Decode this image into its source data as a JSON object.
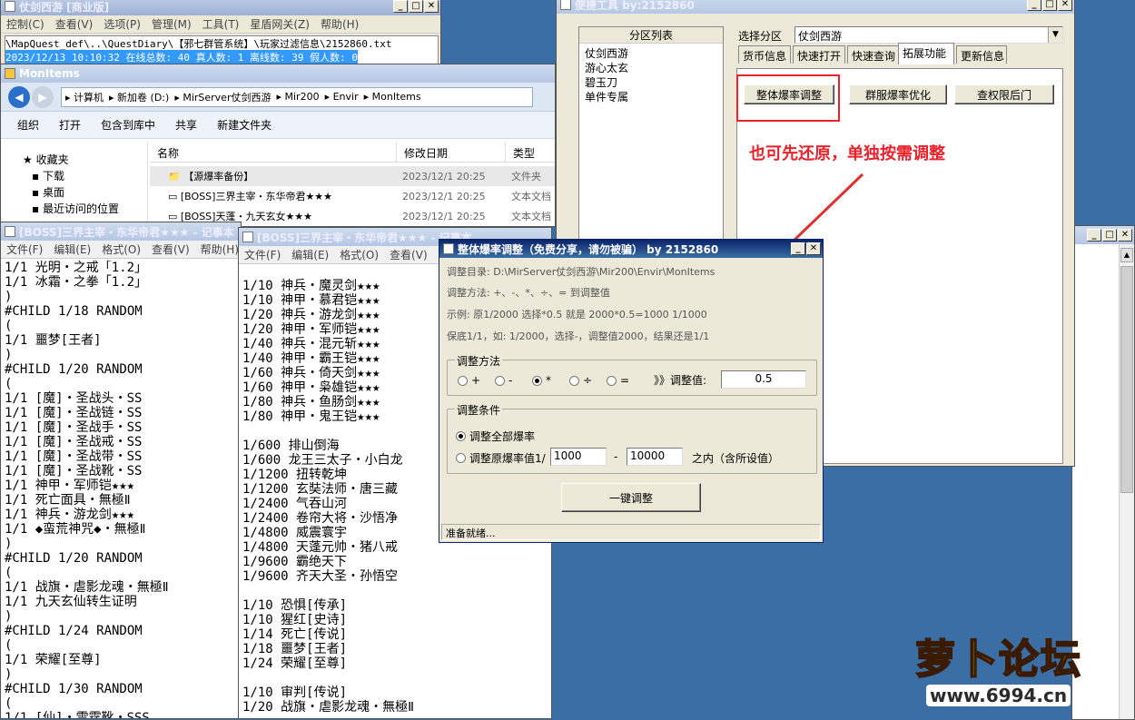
{
  "win_top_left": {
    "title": "仗剑西游 [商业版]",
    "menu": [
      "控制(C)",
      "查看(V)",
      "选项(P)",
      "管理(M)",
      "工具(T)",
      "星盾网关(Z)",
      "帮助(H)"
    ],
    "path_line": "\\MapQuest_def\\..\\QuestDiary\\【邪七群管系统】\\玩家过滤信息\\2152860.txt",
    "status_line": "2023/12/13 10:10:32 在线总数: 40 真人数: 1 离线数: 39 假人数: 0"
  },
  "explorer": {
    "title": "MonItems",
    "breadcrumb": [
      "计算机",
      "新加卷 (D:)",
      "MirServer仗剑西游",
      "Mir200",
      "Envir",
      "MonItems"
    ],
    "toolbar": [
      "组织",
      "打开",
      "包含到库中",
      "共享",
      "新建文件夹"
    ],
    "nav": [
      "收藏夹",
      "下载",
      "桌面",
      "最近访问的位置"
    ],
    "columns": [
      "名称",
      "修改日期",
      "类型"
    ],
    "files": [
      {
        "name": "【源爆率备份】",
        "date": "2023/12/1 20:25",
        "type": "文件夹"
      },
      {
        "name": "[BOSS]三界主宰・东华帝君★★★",
        "date": "2023/12/1 20:25",
        "type": "文本文档"
      },
      {
        "name": "[BOSS]天蓬・九天玄女★★★",
        "date": "2023/12/1 20:25",
        "type": "文本文档"
      }
    ]
  },
  "notepad1": {
    "title": "[BOSS]三界主宰・东华帝君★★★ - 记事本",
    "menu": [
      "文件(F)",
      "编辑(E)",
      "格式(O)",
      "查看(V)",
      "帮助(H)"
    ],
    "lines": [
      "1/1 光明・之戒「1.2」",
      "1/1 冰霜・之拳「1.2」",
      ")",
      "#CHILD 1/18 RANDOM",
      "(",
      "1/1 噩梦[王者]",
      ")",
      "#CHILD 1/20 RANDOM",
      "(",
      "1/1 [魔]・圣战头・SS",
      "1/1 [魔]・圣战链・SS",
      "1/1 [魔]・圣战手・SS",
      "1/1 [魔]・圣战戒・SS",
      "1/1 [魔]・圣战带・SS",
      "1/1 [魔]・圣战靴・SS",
      "1/1 神甲・军师铠★★★",
      "1/1 死亡面具・無極Ⅱ",
      "1/1 神兵・游龙剑★★★",
      "1/1 ◆蛮荒神咒◆・無極Ⅱ",
      ")",
      "#CHILD 1/20 RANDOM",
      "(",
      "1/1 战旗・虐影龙魂・無極Ⅱ",
      "1/1 九天玄仙转生证明",
      ")",
      "#CHILD 1/24 RANDOM",
      "(",
      "1/1 荣耀[至尊]",
      ")",
      "#CHILD 1/30 RANDOM",
      "(",
      "1/1 [仙]・雷霆靴・SSS"
    ]
  },
  "notepad2": {
    "title": "[BOSS]三界主宰・东华帝君★★★ - 记事本",
    "menu": [
      "文件(F)",
      "编辑(E)",
      "格式(O)",
      "查看(V)"
    ],
    "lines": [
      "",
      "1/10 神兵・魔灵剑★★★",
      "1/10 神甲・慕君铠★★★",
      "1/20 神兵・游龙剑★★★",
      "1/20 神甲・军师铠★★★",
      "1/40 神兵・混元斩★★★",
      "1/40 神甲・霸王铠★★★",
      "1/60 神兵・倚天剑★★★",
      "1/60 神甲・枭雄铠★★★",
      "1/80 神兵・鱼肠剑★★★",
      "1/80 神甲・鬼王铠★★★",
      "",
      "1/600 排山倒海",
      "1/600 龙王三太子・小白龙",
      "1/1200 扭转乾坤",
      "1/1200 玄奘法师・唐三藏",
      "1/2400 气吞山河",
      "1/2400 卷帘大将・沙悟净",
      "1/4800 威震寰宇",
      "1/4800 天蓬元帅・猪八戒",
      "1/9600 霸绝天下",
      "1/9600 齐天大圣・孙悟空",
      "",
      "1/10 恐惧[传承]",
      "1/10 猩红[史诗]",
      "1/14 死亡[传说]",
      "1/18 噩梦[王者]",
      "1/24 荣耀[至尊]",
      "",
      "1/10 审判[传说]",
      "1/20 战旗・虐影龙魂・無極Ⅱ"
    ]
  },
  "tool": {
    "title": "便捷工具 by:2152860",
    "list_header": "分区列表",
    "list": [
      "仗剑西游",
      "游心太玄",
      "碧玉刀",
      "单件专属"
    ],
    "select_label": "选择分区",
    "select_value": "仗剑西游",
    "tabs": [
      "货币信息",
      "快速打开",
      "快速查询",
      "拓展功能",
      "更新信息"
    ],
    "buttons": [
      "整体爆率调整",
      "群服爆率优化",
      "查权限后门"
    ],
    "annotation": "也可先还原，单独按需调整"
  },
  "dialog": {
    "title": "整体爆率调整（免费分享，请勿被骗）  by 2152860",
    "dir_line": "调整目录: D:\\MirServer仗剑西游\\Mir200\\Envir\\MonItems",
    "method_line": "调整方法: +、-、*、÷、=  到调整值",
    "example1": "示例: 原1/2000 选择*0.5 就是 2000*0.5=1000  1/1000",
    "example2": "保底1/1，如: 1/2000，选择-，调整值2000，结果还是1/1",
    "group1": "调整方法",
    "ops": [
      "+",
      "-",
      "*",
      "÷",
      "="
    ],
    "value_label": "》》调整值:",
    "value": "0.5",
    "group2": "调整条件",
    "cond1": "调整全部爆率",
    "cond2": "调整原爆率值1/",
    "from": "1000",
    "dash": "-",
    "to": "10000",
    "range_suffix": "之内（含所设值）",
    "action": "一键调整",
    "status": "准备就绪..."
  },
  "watermark": {
    "text": "萝卜论坛",
    "url": "www.6994.cn"
  },
  "colors": {
    "accent_red": "#e8212b",
    "arrow": "#e23030",
    "title_active": "#0a246a",
    "selection": "#3399ff"
  }
}
